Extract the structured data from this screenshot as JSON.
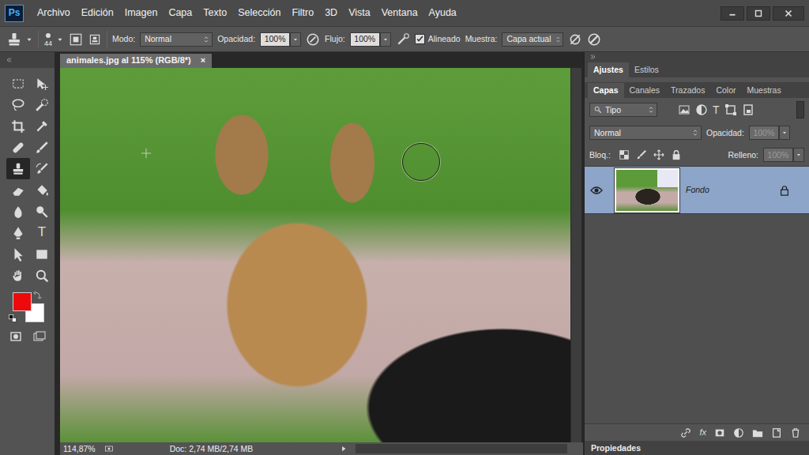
{
  "app": {
    "logo": "Ps"
  },
  "menu": [
    "Archivo",
    "Edición",
    "Imagen",
    "Capa",
    "Texto",
    "Selección",
    "Filtro",
    "3D",
    "Vista",
    "Ventana",
    "Ayuda"
  ],
  "options": {
    "size": "44",
    "mode_label": "Modo:",
    "mode": "Normal",
    "opacity_label": "Opacidad:",
    "opacity": "100%",
    "flow_label": "Flujo:",
    "flow": "100%",
    "aligned": {
      "label": "Alineado",
      "checked": true
    },
    "sample_label": "Muestra:",
    "sample": "Capa actual"
  },
  "tools": [
    {
      "selected": false
    },
    {
      "selected": false
    },
    {
      "selected": false
    },
    {
      "selected": false
    },
    {
      "selected": false
    },
    {
      "selected": false
    },
    {
      "selected": false
    },
    {
      "selected": false
    },
    {
      "selected": true
    },
    {
      "selected": false
    },
    {
      "selected": false
    },
    {
      "selected": false
    },
    {
      "selected": false
    },
    {
      "selected": false
    },
    {
      "selected": false
    },
    {
      "selected": false,
      "label": "T"
    },
    {
      "selected": false
    },
    {
      "selected": false
    },
    {
      "selected": false
    },
    {
      "selected": false
    }
  ],
  "colors": {
    "foreground": "#ee0a0a",
    "background": "#ffffff"
  },
  "document": {
    "tab": "animales.jpg al 115% (RGB/8*)",
    "close": "×",
    "zoom": "114,87%",
    "info": "Doc: 2,74 MB/2,74 MB"
  },
  "panels": {
    "top_tabs": [
      {
        "label": "Ajustes",
        "selected": true
      },
      {
        "label": "Estilos",
        "selected": false
      }
    ],
    "layer_tabs": [
      {
        "label": "Capas",
        "selected": true
      },
      {
        "label": "Canales",
        "selected": false
      },
      {
        "label": "Trazados",
        "selected": false
      },
      {
        "label": "Color",
        "selected": false
      },
      {
        "label": "Muestras",
        "selected": false
      }
    ],
    "filter": "Tipo",
    "filter_type": "T",
    "blend": "Normal",
    "opacity_label": "Opacidad:",
    "opacity": {
      "value": "100%",
      "disabled": true
    },
    "lock_label": "Bloq.:",
    "fill_label": "Relleno:",
    "fill": {
      "value": "100%",
      "disabled": true
    },
    "layers": [
      {
        "name": "Fondo",
        "visible": true,
        "locked": true,
        "selected": true
      }
    ],
    "fx": "fx",
    "properties": "Propiedades"
  }
}
